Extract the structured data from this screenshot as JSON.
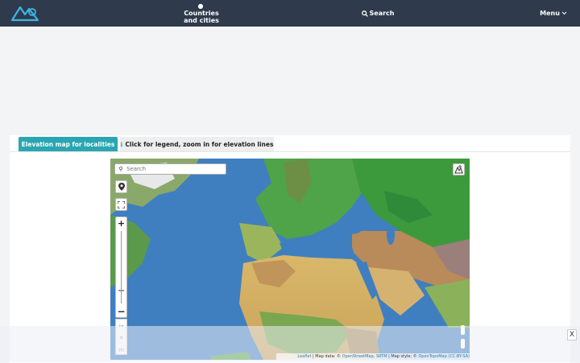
{
  "navbar": {
    "countries_line1": "Countries",
    "countries_line2": "and cities",
    "search_label": "Search",
    "menu_label": "Menu",
    "icons": {
      "countries": "globe-icon",
      "search": "search-icon",
      "menu": "chevron-down-icon"
    }
  },
  "tabs": {
    "active_label": "Elevation map for localities",
    "info_label": "Click for legend, zoom in for elevation lines"
  },
  "map": {
    "search_placeholder": "Search",
    "attribution": {
      "leaflet": "Leaflet",
      "map_data_prefix": " | Map data: © ",
      "osm": "OpenStreetMap",
      "srtm_sep": ", ",
      "srtm": "SRTM",
      "style_prefix": " | Map style: © ",
      "otm": "OpenTopoMap (CC-BY-SA)"
    },
    "controls": {
      "zoom_in": "+",
      "zoom_out": "−",
      "measure_icons": [
        "↦",
        "✕",
        "m"
      ]
    }
  },
  "overlay": {
    "close_label": "X"
  },
  "colors": {
    "navbar": "#2f3b4c",
    "accent": "#2aa6b2",
    "ocean": "#3f7fc0"
  }
}
